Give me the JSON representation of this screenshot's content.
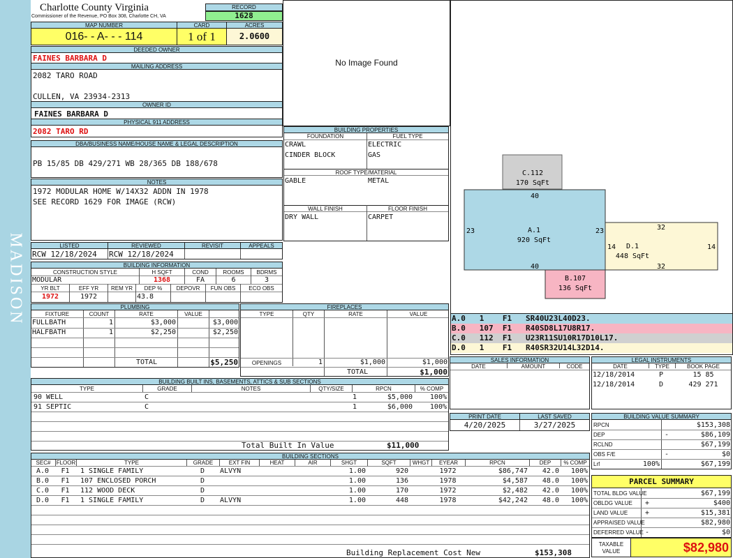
{
  "county": {
    "name": "Charlotte County Virginia",
    "address": "Commissioner of the Revenue, PO Box 308, Charlotte CH, VA"
  },
  "record": {
    "label": "RECORD",
    "value": "1628"
  },
  "map_number": {
    "label": "MAP NUMBER",
    "value": "016- - A- - - 114"
  },
  "card": {
    "label": "CARD",
    "value": "1 of 1"
  },
  "acres": {
    "label": "ACRES",
    "value": "2.0600"
  },
  "deeded_owner": {
    "label": "DEEDED OWNER",
    "value": "FAINES BARBARA D"
  },
  "mailing": {
    "label": "MAILING ADDRESS",
    "line1": "2082 TARO ROAD",
    "line2": "CULLEN, VA 23934-2313"
  },
  "owner_id": {
    "label": "OWNER ID",
    "value": "FAINES BARBARA D"
  },
  "physical": {
    "label": "PHYSICAL 911 ADDRESS",
    "value": "2082 TARO RD"
  },
  "legal_desc": {
    "label": "DBA/BUSINESS NAME/HOUSE NAME & LEGAL DESCRIPTION",
    "value": "PB 15/85 DB 429/271 WB 28/365 DB 188/678"
  },
  "notes": {
    "label": "NOTES",
    "line1": "1972 MODULAR HOME W/14X32 ADDN IN 1978",
    "line2": "SEE RECORD 1629 FOR IMAGE (RCW)"
  },
  "review": {
    "listed_label": "LISTED",
    "reviewed_label": "REVIEWED",
    "revisit_label": "REVISIT",
    "appeals_label": "APPEALS",
    "listed": "RCW 12/18/2024",
    "reviewed": "RCW 12/18/2024",
    "revisit": "",
    "appeals": ""
  },
  "building_info": {
    "label": "BUILDING INFORMATION",
    "construction_label": "CONSTRUCTION STYLE",
    "hsqft_label": "H SQFT",
    "cond_label": "COND",
    "rooms_label": "ROOMS",
    "bdrms_label": "BDRMS",
    "construction": "MODULAR",
    "hsqft": "1368",
    "cond": "FA",
    "rooms": "6",
    "bdrms": "3",
    "yrblt_label": "YR BLT",
    "effyr_label": "EFF YR",
    "remyr_label": "REM YR",
    "dep_label": "DEP %",
    "depovr_label": "DEPOVR",
    "funobs_label": "FUN OBS",
    "ecoobs_label": "ECO OBS",
    "yrblt": "1972",
    "effyr": "1972",
    "remyr": "",
    "dep": "43.8",
    "depovr": "",
    "funobs": "",
    "ecoobs": ""
  },
  "image": {
    "text": "No Image Found"
  },
  "building_props": {
    "label": "BUILDING PROPERTIES",
    "foundation_label": "FOUNDATION",
    "fuel_label": "FUEL TYPE",
    "foundation1": "CRAWL",
    "foundation2": "CINDER BLOCK",
    "fuel1": "ELECTRIC",
    "fuel2": "GAS",
    "roof_label": "ROOF TYPE/MATERIAL",
    "roof_type": "GABLE",
    "roof_material": "METAL",
    "wall_label": "WALL FINISH",
    "floor_label": "FLOOR FINISH",
    "wall": "DRY WALL",
    "floor": "CARPET"
  },
  "sketch": {
    "areas": [
      {
        "id": "C.112",
        "sqft": "170 SqFt",
        "color": "#d0d0d0"
      },
      {
        "id": "A.1",
        "sqft": "920 SqFt",
        "color": "#add8e6"
      },
      {
        "id": "D.1",
        "sqft": "448 SqFt",
        "color": "#fdf7d6"
      },
      {
        "id": "B.107",
        "sqft": "136 SqFt",
        "color": "#f7b5c3"
      }
    ],
    "dims": {
      "a_top": "40",
      "a_left": "23",
      "a_right": "23",
      "a_bottom": "40",
      "d_top": "32",
      "d_left": "14",
      "d_right": "14",
      "d_bottom": "32"
    },
    "codes": [
      {
        "text": "A.0   1    F1   SR40U23L40D23.",
        "color": "#add8e6"
      },
      {
        "text": "B.0   107  F1   R40SD8L17U8R17.",
        "color": "#f7b5c3"
      },
      {
        "text": "C.0   112  F1   U23R11SU10R17D10L17.",
        "color": "#d0d0d0"
      },
      {
        "text": "D.0   1    F1   R40SR32U14L32D14.",
        "color": "#fdf7d6"
      }
    ]
  },
  "plumbing": {
    "label": "PLUMBING",
    "headers": [
      "FIXTURE",
      "COUNT",
      "RATE",
      "VALUE"
    ],
    "rows": [
      [
        "FULLBATH",
        "1",
        "$3,000",
        "$3,000"
      ],
      [
        "HALFBATH",
        "1",
        "$2,250",
        "$2,250"
      ]
    ],
    "total_label": "TOTAL",
    "total": "$5,250"
  },
  "fireplaces": {
    "label": "FIREPLACES",
    "headers": [
      "TYPE",
      "QTY",
      "RATE",
      "VALUE"
    ],
    "openings_label": "OPENINGS",
    "openings_qty": "1",
    "openings_rate": "$1,000",
    "openings_value": "$1,000",
    "total_label": "TOTAL",
    "total": "$1,000"
  },
  "sales": {
    "label": "SALES INFORMATION",
    "headers": [
      "DATE",
      "AMOUNT",
      "CODE"
    ]
  },
  "legal_instruments": {
    "label": "LEGAL INSTRUMENTS",
    "headers": [
      "DATE",
      "TYPE",
      "BOOK PAGE"
    ],
    "rows": [
      [
        "12/18/2014",
        "P",
        "15 85"
      ],
      [
        "12/18/2014",
        "D",
        "429 271"
      ]
    ]
  },
  "builtins": {
    "label": "BUILDING BUILT INS, BASEMENTS, ATTICS & SUB SECTIONS",
    "headers": [
      "TYPE",
      "GRADE",
      "NOTES",
      "QTY/SIZE",
      "RPCN",
      "% COMP"
    ],
    "rows": [
      [
        "90 WELL",
        "C",
        "",
        "1",
        "$5,000",
        "100%"
      ],
      [
        "91 SEPTIC",
        "C",
        "",
        "1",
        "$6,000",
        "100%"
      ]
    ],
    "total_label": "Total Built In Value",
    "total": "$11,000"
  },
  "print_info": {
    "print_label": "PRINT DATE",
    "saved_label": "LAST SAVED",
    "print_date": "4/20/2025",
    "last_saved": "3/27/2025"
  },
  "value_summary": {
    "label": "BUILDING VALUE SUMMARY",
    "rows": [
      {
        "label": "RPCN",
        "sign": "",
        "value": "$153,308"
      },
      {
        "label": "DEP",
        "sign": "-",
        "value": "$86,109"
      },
      {
        "label": "RCLND",
        "sign": "",
        "value": "$67,199"
      },
      {
        "label": "OBS F/E",
        "sign": "-",
        "value": "$0"
      },
      {
        "label": "Lrf",
        "pct": "100%",
        "sign": "",
        "value": "$67,199"
      }
    ]
  },
  "parcel_summary": {
    "label": "PARCEL SUMMARY",
    "rows": [
      {
        "label": "TOTAL BLDG VALUE",
        "sign": "",
        "value": "$67,199"
      },
      {
        "label": "OBLDG VALUE",
        "sign": "+",
        "value": "$400"
      },
      {
        "label": "LAND VALUE",
        "sign": "+",
        "value": "$15,381"
      },
      {
        "label": "APPRAISED VALUE",
        "sign": "",
        "value": "$82,980"
      },
      {
        "label": "DEFERRED VALUE",
        "sign": "-",
        "value": "$0"
      }
    ],
    "taxable_label1": "TAXABLE",
    "taxable_label2": "VALUE",
    "taxable": "$82,980"
  },
  "sections": {
    "label": "BUILDING SECTIONS",
    "headers": [
      "SEC#",
      "FLOOR",
      "TYPE",
      "GRADE",
      "EXT FIN",
      "HEAT",
      "AIR",
      "SHGT",
      "SQFT",
      "WHGT",
      "EYEAR",
      "RPCN",
      "DEP",
      "% COMP"
    ],
    "rows": [
      [
        "A.0",
        "F1",
        "1 SINGLE FAMILY",
        "D",
        "ALVYN",
        "",
        "",
        "1.00",
        "920",
        "",
        "1972",
        "$86,747",
        "42.0",
        "100%"
      ],
      [
        "B.0",
        "F1",
        "107 ENCLOSED PORCH",
        "D",
        "",
        "",
        "",
        "1.00",
        "136",
        "",
        "1978",
        "$4,587",
        "48.0",
        "100%"
      ],
      [
        "C.0",
        "F1",
        "112 WOOD DECK",
        "D",
        "",
        "",
        "",
        "1.00",
        "170",
        "",
        "1972",
        "$2,482",
        "42.0",
        "100%"
      ],
      [
        "D.0",
        "F1",
        "1 SINGLE FAMILY",
        "D",
        "ALVYN",
        "",
        "",
        "1.00",
        "448",
        "",
        "1978",
        "$42,242",
        "48.0",
        "100%"
      ]
    ],
    "total_label": "Building Replacement Cost New",
    "total": "$153,308"
  },
  "sidebar": {
    "text": "MADISON"
  }
}
